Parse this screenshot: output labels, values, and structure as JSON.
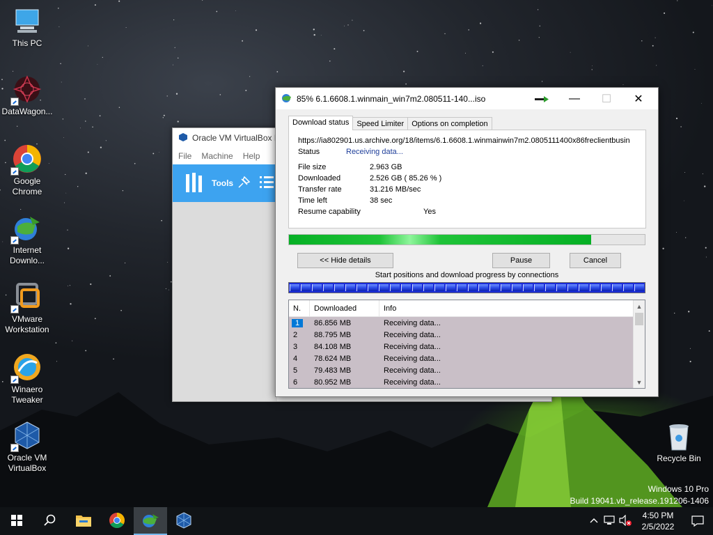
{
  "desktop": {
    "icons": [
      {
        "label": "This PC",
        "icon": "this-pc-icon"
      },
      {
        "label": "DataWagon...",
        "icon": "datawagon-icon"
      },
      {
        "label": "Google Chrome",
        "icon": "chrome-icon"
      },
      {
        "label": "Internet Downlo...",
        "icon": "idm-icon"
      },
      {
        "label": "VMware Workstation",
        "icon": "vmware-icon"
      },
      {
        "label": "Winaero Tweaker",
        "icon": "winaero-icon"
      },
      {
        "label": "Oracle VM VirtualBox",
        "icon": "virtualbox-icon"
      },
      {
        "label": "Recycle Bin",
        "icon": "recycle-bin-icon"
      }
    ],
    "watermark": {
      "line1": "Windows 10 Pro",
      "line2": "Build 19041.vb_release.191206-1406"
    }
  },
  "vbox": {
    "title": "Oracle VM VirtualBox M",
    "menu": [
      "File",
      "Machine",
      "Help"
    ],
    "tools_label": "Tools"
  },
  "idm": {
    "title": "85% 6.1.6608.1.winmain_win7m2.080511-140...iso",
    "tabs": [
      "Download status",
      "Speed Limiter",
      "Options on completion"
    ],
    "url": "https://ia802901.us.archive.org/18/items/6.1.6608.1.winmainwin7m2.0805111400x86freclientbusin",
    "status_label": "Status",
    "status_value": "Receiving data...",
    "fields": [
      {
        "k": "File size",
        "v": "2.963  GB"
      },
      {
        "k": "Downloaded",
        "v": "2.526  GB  ( 85.26 % )"
      },
      {
        "k": "Transfer rate",
        "v": "31.216  MB/sec"
      },
      {
        "k": "Time left",
        "v": "38 sec"
      }
    ],
    "resume_label": "Resume capability",
    "resume_value": "Yes",
    "progress": 0.85,
    "buttons": {
      "hide": "<< Hide details",
      "pause": "Pause",
      "cancel": "Cancel"
    },
    "connections_label": "Start positions and download progress by connections",
    "table": {
      "headers": [
        "N.",
        "Downloaded",
        "Info"
      ],
      "rows": [
        {
          "n": "1",
          "downloaded": "86.856  MB",
          "info": "Receiving data..."
        },
        {
          "n": "2",
          "downloaded": "88.795  MB",
          "info": "Receiving data..."
        },
        {
          "n": "3",
          "downloaded": "84.108  MB",
          "info": "Receiving data..."
        },
        {
          "n": "4",
          "downloaded": "78.624  MB",
          "info": "Receiving data..."
        },
        {
          "n": "5",
          "downloaded": "79.483  MB",
          "info": "Receiving data..."
        },
        {
          "n": "6",
          "downloaded": "80.952  MB",
          "info": "Receiving data..."
        }
      ]
    }
  },
  "taskbar": {
    "time": "4:50 PM",
    "date": "2/5/2022"
  }
}
